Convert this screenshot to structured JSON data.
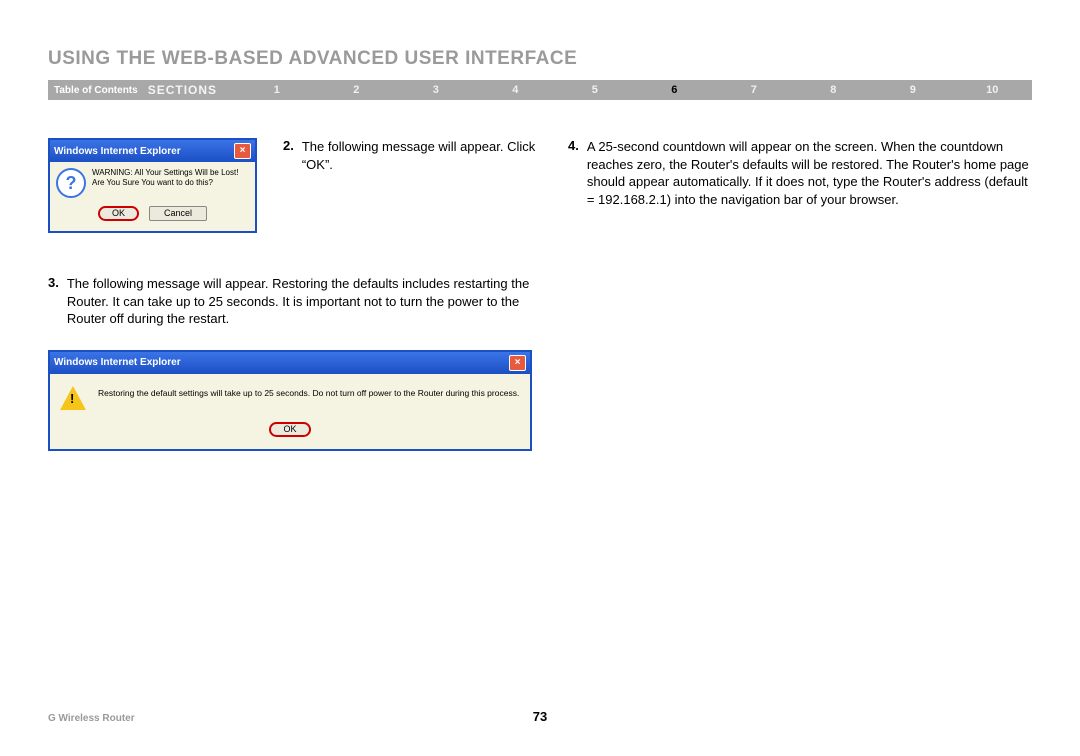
{
  "title": "USING THE WEB-BASED ADVANCED USER INTERFACE",
  "nav": {
    "toc": "Table of Contents",
    "sections_label": "SECTIONS",
    "numbers": [
      "1",
      "2",
      "3",
      "4",
      "5",
      "6",
      "7",
      "8",
      "9",
      "10"
    ],
    "active": "6"
  },
  "dialog1": {
    "title": "Windows Internet Explorer",
    "msg_line1": "WARNING: All Your Settings Will be Lost!",
    "msg_line2": "Are You Sure You want to do this?",
    "ok": "OK",
    "cancel": "Cancel"
  },
  "step2": {
    "num": "2.",
    "text": "The following message will appear. Click “OK”."
  },
  "step3": {
    "num": "3.",
    "text": "The following message will appear. Restoring the defaults includes restarting the Router. It can take up to 25 seconds. It is important not to turn the power to the Router off during the restart."
  },
  "dialog2": {
    "title": "Windows Internet Explorer",
    "msg": "Restoring the default settings will take up to 25 seconds. Do not turn off power to the Router during this process.",
    "ok": "OK"
  },
  "step4": {
    "num": "4.",
    "text": "A 25-second countdown will appear on the screen. When the countdown reaches zero, the Router's defaults will be restored. The Router's home page should appear automatically. If it does not, type the Router's address (default = 192.168.2.1) into the navigation bar of your browser."
  },
  "footer": "G Wireless Router",
  "page_number": "73"
}
